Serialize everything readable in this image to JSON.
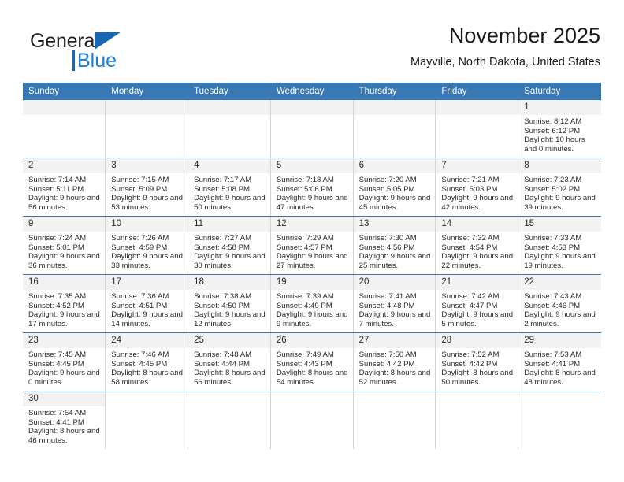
{
  "brand": {
    "name_top": "General",
    "name_bottom": "Blue",
    "color_black": "#231f20",
    "color_blue": "#1a7fd4",
    "triangle_color": "#1668b3"
  },
  "header": {
    "title": "November 2025",
    "subtitle": "Mayville, North Dakota, United States"
  },
  "theme": {
    "header_row_bg": "#3878b4",
    "header_row_text": "#ffffff",
    "daynum_bg": "#f2f2f2",
    "row_divider": "#3878b4",
    "cell_divider": "#d4d4d4"
  },
  "weekdays": [
    "Sunday",
    "Monday",
    "Tuesday",
    "Wednesday",
    "Thursday",
    "Friday",
    "Saturday"
  ],
  "labels": {
    "sunrise": "Sunrise:",
    "sunset": "Sunset:",
    "daylight": "Daylight:"
  },
  "weeks": [
    [
      {
        "empty": true
      },
      {
        "empty": true
      },
      {
        "empty": true
      },
      {
        "empty": true
      },
      {
        "empty": true
      },
      {
        "empty": true
      },
      {
        "day": "1",
        "sunrise": "Sunrise: 8:12 AM",
        "sunset": "Sunset: 6:12 PM",
        "daylight": "Daylight: 10 hours and 0 minutes."
      }
    ],
    [
      {
        "day": "2",
        "sunrise": "Sunrise: 7:14 AM",
        "sunset": "Sunset: 5:11 PM",
        "daylight": "Daylight: 9 hours and 56 minutes."
      },
      {
        "day": "3",
        "sunrise": "Sunrise: 7:15 AM",
        "sunset": "Sunset: 5:09 PM",
        "daylight": "Daylight: 9 hours and 53 minutes."
      },
      {
        "day": "4",
        "sunrise": "Sunrise: 7:17 AM",
        "sunset": "Sunset: 5:08 PM",
        "daylight": "Daylight: 9 hours and 50 minutes."
      },
      {
        "day": "5",
        "sunrise": "Sunrise: 7:18 AM",
        "sunset": "Sunset: 5:06 PM",
        "daylight": "Daylight: 9 hours and 47 minutes."
      },
      {
        "day": "6",
        "sunrise": "Sunrise: 7:20 AM",
        "sunset": "Sunset: 5:05 PM",
        "daylight": "Daylight: 9 hours and 45 minutes."
      },
      {
        "day": "7",
        "sunrise": "Sunrise: 7:21 AM",
        "sunset": "Sunset: 5:03 PM",
        "daylight": "Daylight: 9 hours and 42 minutes."
      },
      {
        "day": "8",
        "sunrise": "Sunrise: 7:23 AM",
        "sunset": "Sunset: 5:02 PM",
        "daylight": "Daylight: 9 hours and 39 minutes."
      }
    ],
    [
      {
        "day": "9",
        "sunrise": "Sunrise: 7:24 AM",
        "sunset": "Sunset: 5:01 PM",
        "daylight": "Daylight: 9 hours and 36 minutes."
      },
      {
        "day": "10",
        "sunrise": "Sunrise: 7:26 AM",
        "sunset": "Sunset: 4:59 PM",
        "daylight": "Daylight: 9 hours and 33 minutes."
      },
      {
        "day": "11",
        "sunrise": "Sunrise: 7:27 AM",
        "sunset": "Sunset: 4:58 PM",
        "daylight": "Daylight: 9 hours and 30 minutes."
      },
      {
        "day": "12",
        "sunrise": "Sunrise: 7:29 AM",
        "sunset": "Sunset: 4:57 PM",
        "daylight": "Daylight: 9 hours and 27 minutes."
      },
      {
        "day": "13",
        "sunrise": "Sunrise: 7:30 AM",
        "sunset": "Sunset: 4:56 PM",
        "daylight": "Daylight: 9 hours and 25 minutes."
      },
      {
        "day": "14",
        "sunrise": "Sunrise: 7:32 AM",
        "sunset": "Sunset: 4:54 PM",
        "daylight": "Daylight: 9 hours and 22 minutes."
      },
      {
        "day": "15",
        "sunrise": "Sunrise: 7:33 AM",
        "sunset": "Sunset: 4:53 PM",
        "daylight": "Daylight: 9 hours and 19 minutes."
      }
    ],
    [
      {
        "day": "16",
        "sunrise": "Sunrise: 7:35 AM",
        "sunset": "Sunset: 4:52 PM",
        "daylight": "Daylight: 9 hours and 17 minutes."
      },
      {
        "day": "17",
        "sunrise": "Sunrise: 7:36 AM",
        "sunset": "Sunset: 4:51 PM",
        "daylight": "Daylight: 9 hours and 14 minutes."
      },
      {
        "day": "18",
        "sunrise": "Sunrise: 7:38 AM",
        "sunset": "Sunset: 4:50 PM",
        "daylight": "Daylight: 9 hours and 12 minutes."
      },
      {
        "day": "19",
        "sunrise": "Sunrise: 7:39 AM",
        "sunset": "Sunset: 4:49 PM",
        "daylight": "Daylight: 9 hours and 9 minutes."
      },
      {
        "day": "20",
        "sunrise": "Sunrise: 7:41 AM",
        "sunset": "Sunset: 4:48 PM",
        "daylight": "Daylight: 9 hours and 7 minutes."
      },
      {
        "day": "21",
        "sunrise": "Sunrise: 7:42 AM",
        "sunset": "Sunset: 4:47 PM",
        "daylight": "Daylight: 9 hours and 5 minutes."
      },
      {
        "day": "22",
        "sunrise": "Sunrise: 7:43 AM",
        "sunset": "Sunset: 4:46 PM",
        "daylight": "Daylight: 9 hours and 2 minutes."
      }
    ],
    [
      {
        "day": "23",
        "sunrise": "Sunrise: 7:45 AM",
        "sunset": "Sunset: 4:45 PM",
        "daylight": "Daylight: 9 hours and 0 minutes."
      },
      {
        "day": "24",
        "sunrise": "Sunrise: 7:46 AM",
        "sunset": "Sunset: 4:45 PM",
        "daylight": "Daylight: 8 hours and 58 minutes."
      },
      {
        "day": "25",
        "sunrise": "Sunrise: 7:48 AM",
        "sunset": "Sunset: 4:44 PM",
        "daylight": "Daylight: 8 hours and 56 minutes."
      },
      {
        "day": "26",
        "sunrise": "Sunrise: 7:49 AM",
        "sunset": "Sunset: 4:43 PM",
        "daylight": "Daylight: 8 hours and 54 minutes."
      },
      {
        "day": "27",
        "sunrise": "Sunrise: 7:50 AM",
        "sunset": "Sunset: 4:42 PM",
        "daylight": "Daylight: 8 hours and 52 minutes."
      },
      {
        "day": "28",
        "sunrise": "Sunrise: 7:52 AM",
        "sunset": "Sunset: 4:42 PM",
        "daylight": "Daylight: 8 hours and 50 minutes."
      },
      {
        "day": "29",
        "sunrise": "Sunrise: 7:53 AM",
        "sunset": "Sunset: 4:41 PM",
        "daylight": "Daylight: 8 hours and 48 minutes."
      }
    ],
    [
      {
        "day": "30",
        "sunrise": "Sunrise: 7:54 AM",
        "sunset": "Sunset: 4:41 PM",
        "daylight": "Daylight: 8 hours and 46 minutes."
      },
      {
        "blank": true
      },
      {
        "blank": true
      },
      {
        "blank": true
      },
      {
        "blank": true
      },
      {
        "blank": true
      },
      {
        "blank": true
      }
    ]
  ]
}
